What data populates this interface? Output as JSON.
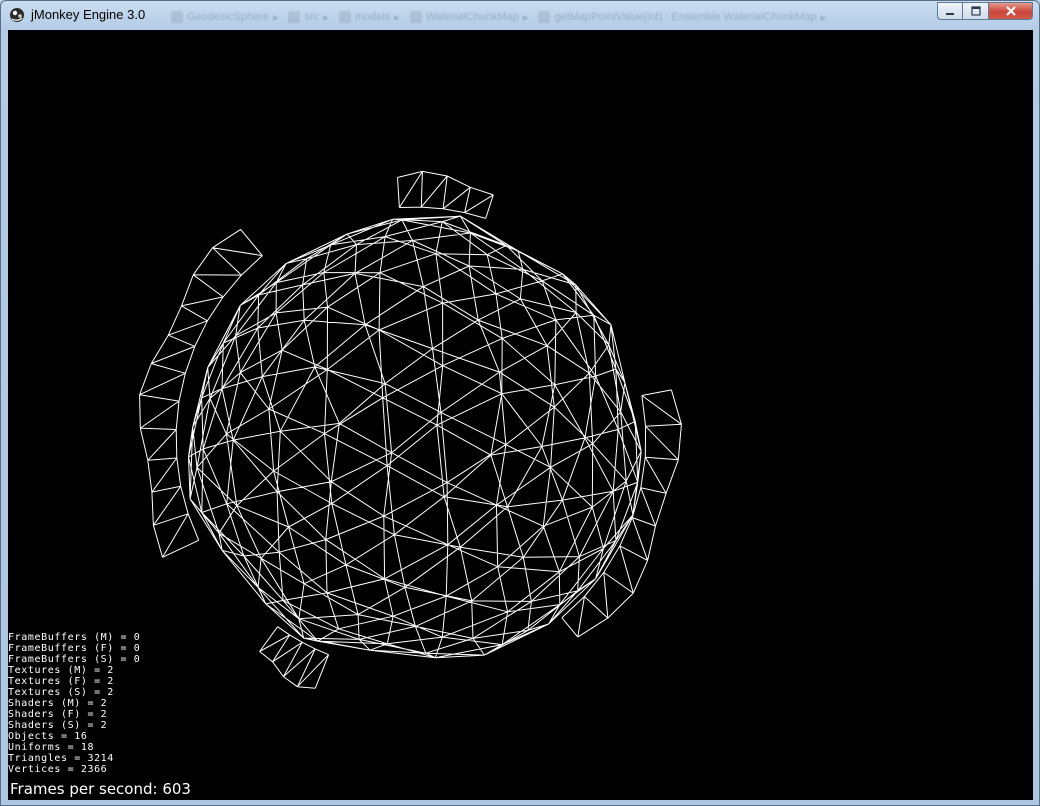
{
  "window": {
    "title": "jMonkey Engine 3.0",
    "buttons": {
      "minimize": "minimize-icon",
      "maximize": "maximize-icon",
      "close": "close-icon"
    }
  },
  "background_tabs": [
    "GeodesicSphere",
    "src",
    "models",
    "WaterialChunkMap",
    "getMapPointValue(int) : Ensemble WaterialChunkMap"
  ],
  "stats": [
    "FrameBuffers (M) = 0",
    "FrameBuffers (F) = 0",
    "FrameBuffers (S) = 0",
    "Textures (M) = 2",
    "Textures (F) = 2",
    "Textures (S) = 2",
    "Shaders (M) = 2",
    "Shaders (F) = 2",
    "Shaders (S) = 2",
    "Objects = 16",
    "Uniforms = 18",
    "Triangles = 3214",
    "Vertices = 2366"
  ],
  "fps_text": "Frames per second: 603",
  "colors": {
    "viewport": "#000000",
    "wireframe": "#ffffff",
    "text": "#ffffff"
  }
}
